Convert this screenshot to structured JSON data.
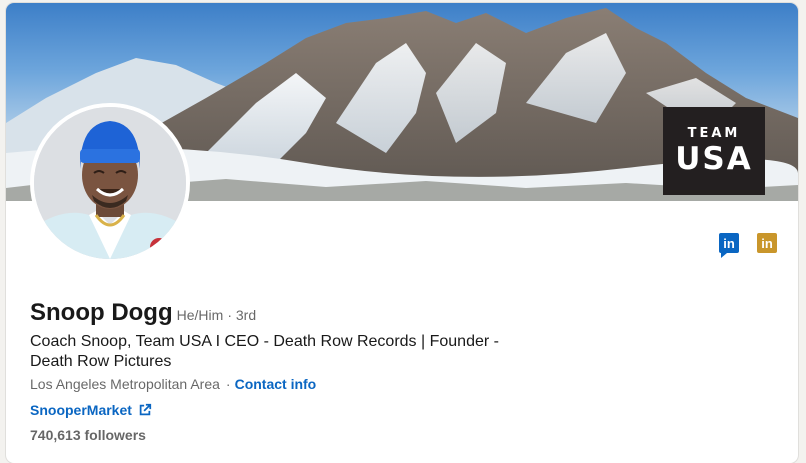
{
  "banner": {
    "badge_line1": "TEAM",
    "badge_line2": "USA"
  },
  "profile": {
    "name": "Snoop Dogg",
    "pronouns": "He/Him",
    "degree": "· 3rd",
    "headline": "Coach Snoop, Team USA I CEO - Death Row Records | Founder - Death Row Pictures",
    "location": "Los Angeles Metropolitan Area",
    "separator": "·",
    "contact_label": "Contact info",
    "website_label": "SnooperMarket",
    "followers": "740,613 followers"
  },
  "social_icons": [
    {
      "icon": "linkedin-icon",
      "label": "in",
      "color": "#0a66c2"
    },
    {
      "icon": "linkedin-icon",
      "label": "in",
      "color": "#c9962b"
    }
  ],
  "colors": {
    "link": "#0a66c2",
    "badge_bg": "#231f20"
  }
}
